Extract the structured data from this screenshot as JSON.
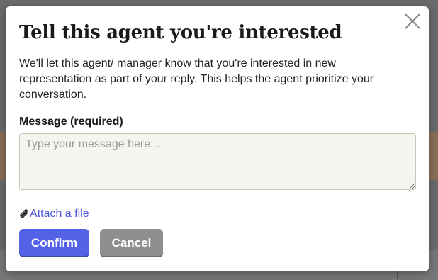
{
  "modal": {
    "title": "Tell this agent you're interested",
    "description": "We'll let this agent/ manager know that you're interested in new representation as part of your reply. This helps the agent prioritize your conversation.",
    "message_label": "Message (required)",
    "message_placeholder": "Type your message here...",
    "message_value": "",
    "attach_label": "Attach a file",
    "confirm_label": "Confirm",
    "cancel_label": "Cancel"
  },
  "icons": {
    "close": "close-icon",
    "attach": "paperclip-icon"
  },
  "colors": {
    "confirm": "#5462e8",
    "cancel": "#8f8f8f",
    "link": "#4a56d6"
  }
}
